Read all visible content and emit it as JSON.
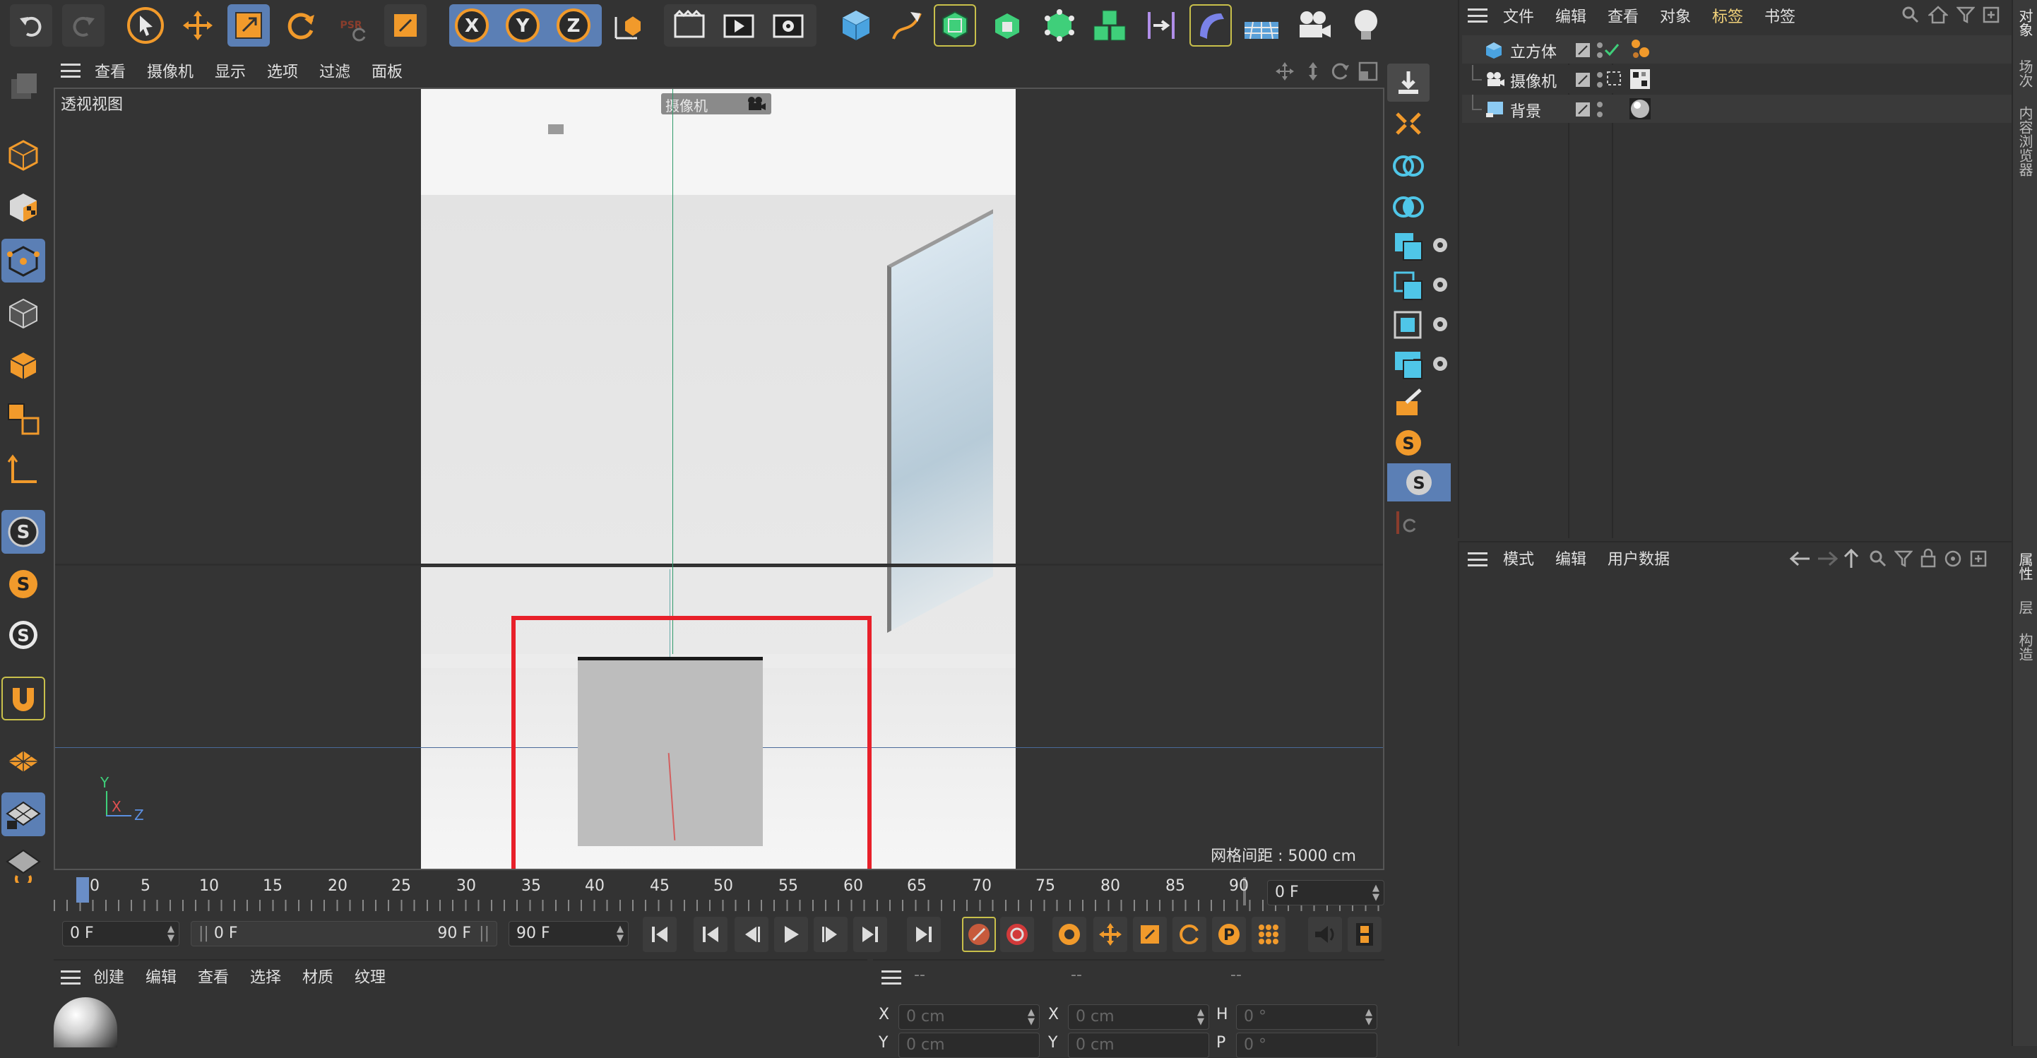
{
  "colors": {
    "accent_orange": "#f19a2b",
    "highlight_blue": "#5b7fb5",
    "viewport_bg": "#343434",
    "selection_red": "#e8202a",
    "cube_gray": "#bdbdbd"
  },
  "top_toolbar": {
    "icons": [
      "undo-icon",
      "redo-icon",
      "select-cursor-icon",
      "move-icon",
      "scale-icon",
      "rotate-icon",
      "psr-icon",
      "live-select-icon",
      "x-axis-lock-icon",
      "y-axis-lock-icon",
      "z-axis-lock-icon",
      "coordinate-system-icon",
      "render-region-icon",
      "render-view-icon",
      "render-settings-icon",
      "cube-primitive-icon",
      "pen-spline-icon",
      "subdivision-icon",
      "extrude-icon",
      "cloner-icon",
      "array-icon",
      "symmetry-icon",
      "deformer-icon",
      "floor-icon",
      "camera-icon",
      "light-icon"
    ],
    "psr_label": "PSR"
  },
  "viewport_menu": {
    "items": [
      "查看",
      "摄像机",
      "显示",
      "选项",
      "过滤",
      "面板"
    ]
  },
  "viewport": {
    "view_name": "透视视图",
    "camera_badge": "摄像机",
    "grid_spacing": "网格间距 : 5000 cm",
    "axis": {
      "y": "Y",
      "x": "X",
      "z": "Z"
    }
  },
  "timeline": {
    "ticks": [
      "0",
      "5",
      "10",
      "15",
      "20",
      "25",
      "30",
      "35",
      "40",
      "45",
      "50",
      "55",
      "60",
      "65",
      "70",
      "75",
      "80",
      "85",
      "90"
    ],
    "current_frame_field": "0 F",
    "start_field": "0 F",
    "range_start": "0 F",
    "range_end": "90 F",
    "end_field": "90 F"
  },
  "material_manager": {
    "menu": [
      "创建",
      "编辑",
      "查看",
      "选择",
      "材质",
      "纹理"
    ]
  },
  "coordinates": {
    "header": [
      "--",
      "--",
      "--"
    ],
    "row1": {
      "pos_label": "X",
      "pos_value": "0 cm",
      "size_label": "X",
      "size_value": "0 cm",
      "rot_label": "H",
      "rot_value": "0 °"
    },
    "row2": {
      "pos_label": "Y",
      "pos_value": "0 cm",
      "size_label": "Y",
      "size_value": "0 cm",
      "rot_label": "P",
      "rot_value": "0 °"
    }
  },
  "object_manager": {
    "menu": [
      "文件",
      "编辑",
      "查看",
      "对象",
      "标签",
      "书签"
    ],
    "active_menu": "标签",
    "objects": [
      {
        "name": "立方体",
        "icon": "cube-object-icon"
      },
      {
        "name": "摄像机",
        "icon": "camera-object-icon"
      },
      {
        "name": "背景",
        "icon": "background-object-icon"
      }
    ]
  },
  "attribute_manager": {
    "menu": [
      "模式",
      "编辑",
      "用户数据"
    ]
  },
  "right_vertical_tabs": {
    "top": [
      "对象",
      "场次",
      "内容浏览器"
    ],
    "bottom": [
      "属性",
      "层",
      "构造"
    ]
  }
}
